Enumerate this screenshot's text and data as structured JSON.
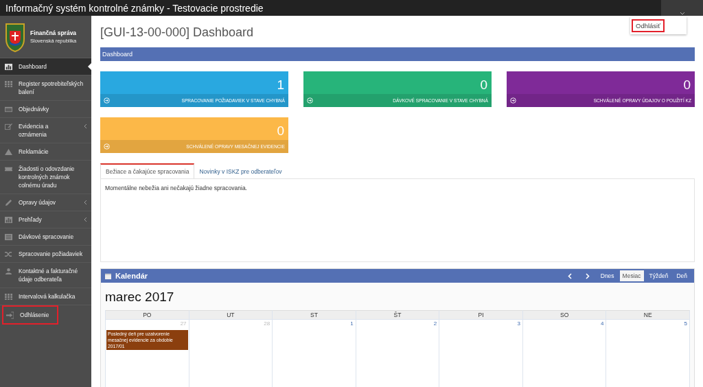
{
  "top_bar": {
    "title": "Informačný systém kontrolné známky - Testovacie prostredie",
    "user_menu": {
      "expanded": true,
      "items": [
        {
          "label": "Odhlásiť",
          "highlighted": true
        }
      ]
    }
  },
  "sidebar": {
    "brand": {
      "name": "Finančná správa",
      "subtitle": "Slovenská republika"
    },
    "items": [
      {
        "label": "Dashboard",
        "selected": true,
        "has_submenu": false,
        "highlighted": false
      },
      {
        "label": "Register spotrebiteľských balení",
        "selected": false,
        "has_submenu": false,
        "highlighted": false
      },
      {
        "label": "Objednávky",
        "selected": false,
        "has_submenu": false,
        "highlighted": false
      },
      {
        "label": "Evidencia a oznámenia",
        "selected": false,
        "has_submenu": true,
        "highlighted": false
      },
      {
        "label": "Reklamácie",
        "selected": false,
        "has_submenu": false,
        "highlighted": false
      },
      {
        "label": "Žiadosti o odovzdanie kontrolných známok colnému úradu",
        "selected": false,
        "has_submenu": false,
        "highlighted": false
      },
      {
        "label": "Opravy údajov",
        "selected": false,
        "has_submenu": true,
        "highlighted": false
      },
      {
        "label": "Prehľady",
        "selected": false,
        "has_submenu": true,
        "highlighted": false
      },
      {
        "label": "Dávkové spracovanie",
        "selected": false,
        "has_submenu": false,
        "highlighted": false
      },
      {
        "label": "Spracovanie požiadaviek",
        "selected": false,
        "has_submenu": false,
        "highlighted": false
      },
      {
        "label": "Kontaktné a fakturačné údaje odberateľa",
        "selected": false,
        "has_submenu": false,
        "highlighted": false
      },
      {
        "label": "Intervalová kalkulačka",
        "selected": false,
        "has_submenu": false,
        "highlighted": false
      },
      {
        "label": "Odhlásenie",
        "selected": false,
        "has_submenu": false,
        "highlighted": true
      }
    ]
  },
  "page": {
    "title": "[GUI-13-00-000] Dashboard",
    "breadcrumb": "Dashboard"
  },
  "tiles": [
    {
      "count": "1",
      "label": "SPRACOVANIE POŽIADAVIEK V STAVE CHYBNÁ",
      "color": "#29a8e0"
    },
    {
      "count": "0",
      "label": "DÁVKOVÉ SPRACOVANIE V STAVE CHYBNÁ",
      "color": "#27b47a"
    },
    {
      "count": "0",
      "label": "SCHVÁLENÉ OPRAVY ÚDAJOV O POUŽITÍ KZ",
      "color": "#7f2a98"
    },
    {
      "count": "0",
      "label": "SCHVÁLENÉ OPRAVY MESAČNEJ EVIDENCIE",
      "color": "#fcb848"
    }
  ],
  "tabs": [
    {
      "label": "Bežiace a čakajúce spracovania",
      "selected": true
    },
    {
      "label": "Novinky v ISKZ pre odberateľov",
      "selected": false
    }
  ],
  "tab_content": "Momentálne nebežia ani nečakajú žiadne spracovania.",
  "calendar": {
    "title": "Kalendár",
    "views": [
      {
        "label": "Dnes",
        "selected": false
      },
      {
        "label": "Mesiac",
        "selected": true
      },
      {
        "label": "Týždeň",
        "selected": false
      },
      {
        "label": "Deň",
        "selected": false
      }
    ],
    "month": "marec 2017",
    "weekdays": [
      "PO",
      "UT",
      "ST",
      "ŠT",
      "PI",
      "SO",
      "NE"
    ],
    "days": [
      {
        "day": "27",
        "other_month": true,
        "events": [
          {
            "text": "Posledný deň pre uzatvorenie mesačnej evidencie za obdobie 2017/01",
            "color": "#8b3f0e"
          }
        ]
      },
      {
        "day": "28",
        "other_month": true
      },
      {
        "day": "1",
        "other_month": false
      },
      {
        "day": "2",
        "other_month": false
      },
      {
        "day": "3",
        "other_month": false
      },
      {
        "day": "4",
        "other_month": false
      },
      {
        "day": "5",
        "other_month": false
      }
    ]
  }
}
